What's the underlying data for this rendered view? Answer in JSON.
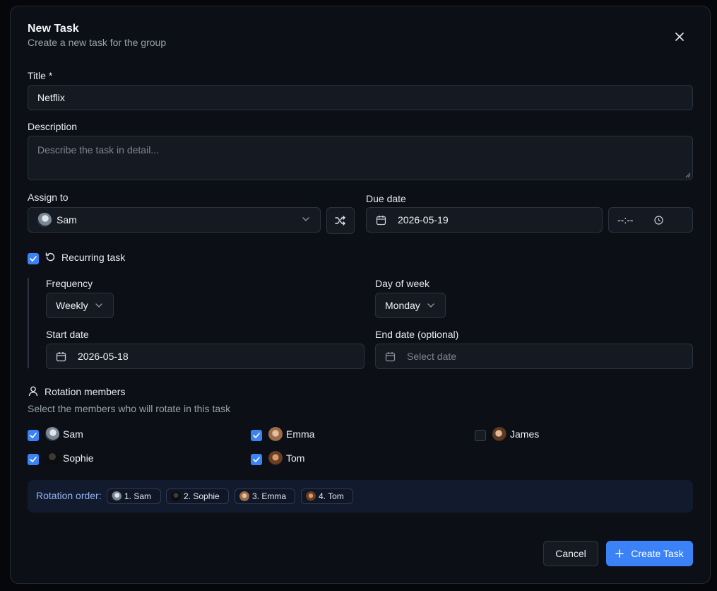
{
  "dialog": {
    "title": "New Task",
    "subtitle": "Create a new task for the group"
  },
  "form": {
    "title_label": "Title *",
    "title_value": "Netflix",
    "description_label": "Description",
    "description_placeholder": "Describe the task in detail...",
    "assign_label": "Assign to",
    "assign_value": "Sam",
    "due_label": "Due date",
    "due_date_value": "2026-05-19",
    "due_time_value": "--:--",
    "recurring_label": "Recurring task",
    "recurring_checked": true,
    "frequency_label": "Frequency",
    "frequency_value": "Weekly",
    "day_label": "Day of week",
    "day_value": "Monday",
    "start_label": "Start date",
    "start_value": "2026-05-18",
    "end_label": "End date (optional)",
    "end_placeholder": "Select date"
  },
  "rotation": {
    "heading": "Rotation members",
    "hint": "Select the members who will rotate in this task",
    "members": [
      {
        "name": "Sam",
        "checked": true
      },
      {
        "name": "Emma",
        "checked": true
      },
      {
        "name": "James",
        "checked": false
      },
      {
        "name": "Sophie",
        "checked": true
      },
      {
        "name": "Tom",
        "checked": true
      }
    ],
    "order_label": "Rotation order:",
    "order": [
      "1. Sam",
      "2. Sophie",
      "3. Emma",
      "4. Tom"
    ]
  },
  "actions": {
    "cancel": "Cancel",
    "create": "Create Task"
  },
  "colors": {
    "accent": "#3b82f6",
    "background": "#0c1016",
    "field": "#151a22",
    "rotation_bar": "#121a2e"
  },
  "icons": {
    "close": "close-icon",
    "shuffle": "shuffle-icon",
    "calendar": "calendar-icon",
    "clock": "clock-icon",
    "repeat": "repeat-icon",
    "user": "user-icon",
    "plus": "plus-icon",
    "chevron": "chevron-down-icon",
    "check": "check-icon"
  }
}
